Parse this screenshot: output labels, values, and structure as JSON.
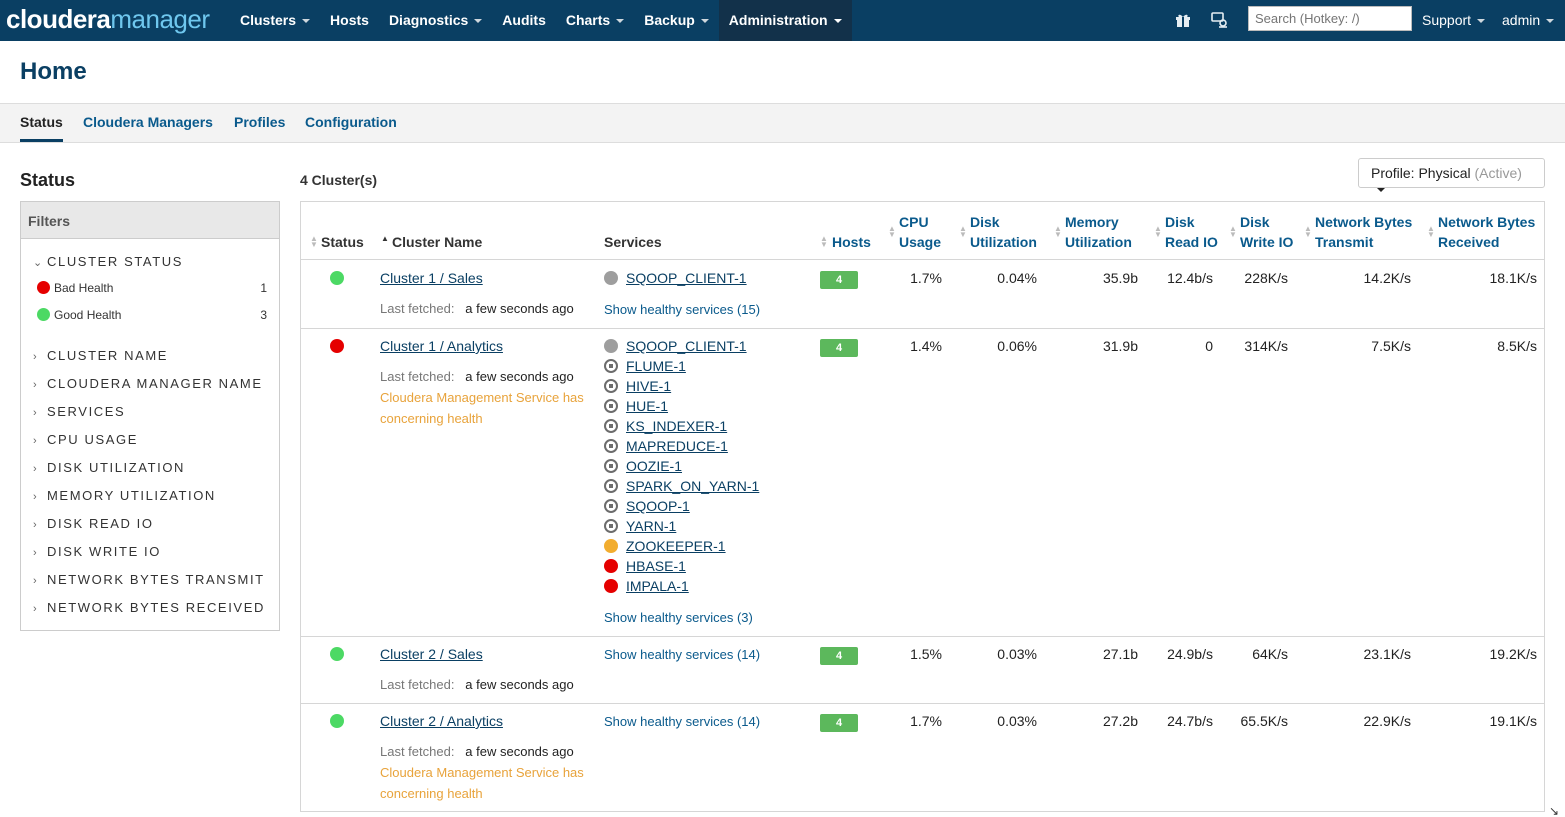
{
  "app": {
    "logo_main": "cloudera",
    "logo_sub": "manager"
  },
  "nav": {
    "items": [
      {
        "label": "Clusters",
        "dropdown": true
      },
      {
        "label": "Hosts",
        "dropdown": false
      },
      {
        "label": "Diagnostics",
        "dropdown": true
      },
      {
        "label": "Audits",
        "dropdown": false
      },
      {
        "label": "Charts",
        "dropdown": true
      },
      {
        "label": "Backup",
        "dropdown": true
      },
      {
        "label": "Administration",
        "dropdown": true,
        "active": true
      }
    ],
    "search_placeholder": "Search (Hotkey: /)",
    "support": "Support",
    "user": "admin"
  },
  "page": {
    "title": "Home",
    "tabs": [
      "Status",
      "Cloudera Managers",
      "Profiles",
      "Configuration"
    ]
  },
  "sidebar": {
    "title": "Status",
    "filters_label": "Filters",
    "cluster_status_label": "CLUSTER STATUS",
    "bad_health": {
      "label": "Bad Health",
      "count": "1"
    },
    "good_health": {
      "label": "Good Health",
      "count": "3"
    },
    "facets": [
      "CLUSTER NAME",
      "CLOUDERA MANAGER NAME",
      "SERVICES",
      "CPU USAGE",
      "DISK UTILIZATION",
      "MEMORY UTILIZATION",
      "DISK READ IO",
      "DISK WRITE IO",
      "NETWORK BYTES TRANSMIT",
      "NETWORK BYTES RECEIVED"
    ]
  },
  "main": {
    "cluster_count": "4 Cluster(s)",
    "profile_label": "Profile: Physical",
    "profile_state": "(Active)",
    "columns": {
      "status": "Status",
      "cluster_name": "Cluster Name",
      "services": "Services",
      "hosts": "Hosts",
      "cpu_1": "CPU",
      "cpu_2": "Usage",
      "disk_1": "Disk",
      "disk_2": "Utilization",
      "mem_1": "Memory",
      "mem_2": "Utilization",
      "dread_1": "Disk",
      "dread_2": "Read IO",
      "dwrite_1": "Disk",
      "dwrite_2": "Write IO",
      "ntx_1": "Network Bytes",
      "ntx_2": "Transmit",
      "nrx_1": "Network Bytes",
      "nrx_2": "Received"
    },
    "fetched_label": "Last fetched:",
    "fetched_value": "a few seconds ago",
    "warning_1": "Cloudera Management Service has",
    "warning_2": "concerning health",
    "clusters": [
      {
        "name": "Cluster 1 / Sales",
        "status_color": "#4cd964",
        "show_healthy": "Show healthy services (15)",
        "hosts": "4",
        "cpu": "1.7%",
        "disk": "0.04%",
        "mem": "35.9b",
        "dread": "12.4b/s",
        "dwrite": "228K/s",
        "ntx": "14.2K/s",
        "nrx": "18.1K/s"
      },
      {
        "name": "Cluster 1 / Analytics",
        "status_color": "#e50000",
        "show_healthy": "Show healthy services (3)",
        "hosts": "4",
        "cpu": "1.4%",
        "disk": "0.06%",
        "mem": "31.9b",
        "dread": "0",
        "dwrite": "314K/s",
        "ntx": "7.5K/s",
        "nrx": "8.5K/s"
      },
      {
        "name": "Cluster 2 / Sales",
        "status_color": "#4cd964",
        "show_healthy": "Show healthy services (14)",
        "hosts": "4",
        "cpu": "1.5%",
        "disk": "0.03%",
        "mem": "27.1b",
        "dread": "24.9b/s",
        "dwrite": "64K/s",
        "ntx": "23.1K/s",
        "nrx": "19.2K/s"
      },
      {
        "name": "Cluster 2 / Analytics",
        "status_color": "#4cd964",
        "show_healthy": "Show healthy services (14)",
        "hosts": "4",
        "cpu": "1.7%",
        "disk": "0.03%",
        "mem": "27.2b",
        "dread": "24.7b/s",
        "dwrite": "65.5K/s",
        "ntx": "22.9K/s",
        "nrx": "19.1K/s"
      }
    ],
    "sales1_services": [
      {
        "name": "SQOOP_CLIENT-1",
        "state": "grey"
      }
    ],
    "analytics1_services": [
      {
        "name": "SQOOP_CLIENT-1",
        "state": "grey"
      },
      {
        "name": "FLUME-1",
        "state": "stopped"
      },
      {
        "name": "HIVE-1",
        "state": "stopped"
      },
      {
        "name": "HUE-1",
        "state": "stopped"
      },
      {
        "name": "KS_INDEXER-1",
        "state": "stopped"
      },
      {
        "name": "MAPREDUCE-1",
        "state": "stopped"
      },
      {
        "name": "OOZIE-1",
        "state": "stopped"
      },
      {
        "name": "SPARK_ON_YARN-1",
        "state": "stopped"
      },
      {
        "name": "SQOOP-1",
        "state": "stopped"
      },
      {
        "name": "YARN-1",
        "state": "stopped"
      },
      {
        "name": "ZOOKEEPER-1",
        "state": "orange"
      },
      {
        "name": "HBASE-1",
        "state": "red"
      },
      {
        "name": "IMPALA-1",
        "state": "red"
      }
    ]
  }
}
